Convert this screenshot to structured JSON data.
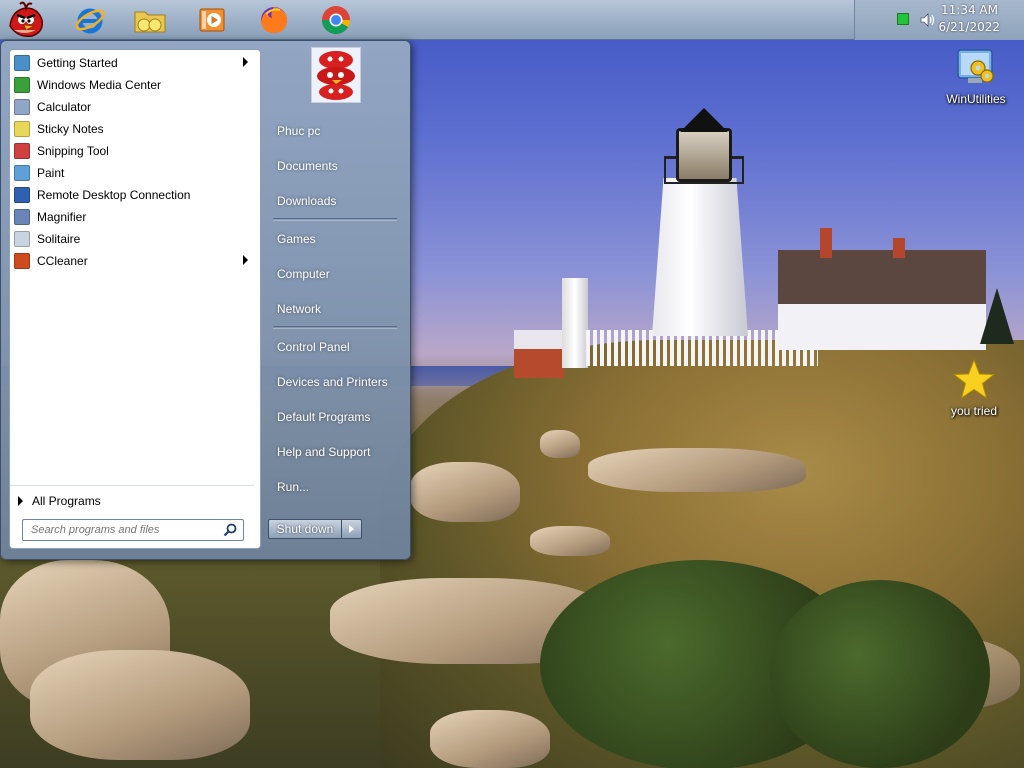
{
  "taskbar": {
    "pinned": [
      {
        "name": "start-orb",
        "icon": "angry-bird-orb-icon"
      },
      {
        "name": "internet-explorer",
        "icon": "internet-explorer-icon"
      },
      {
        "name": "file-explorer",
        "icon": "folder-icon"
      },
      {
        "name": "media-player",
        "icon": "media-player-icon"
      },
      {
        "name": "firefox",
        "icon": "firefox-icon"
      },
      {
        "name": "chrome",
        "icon": "chrome-icon"
      }
    ],
    "tray": {
      "network_icon": "network-status-icon",
      "volume_icon": "speaker-icon",
      "time": "11:34 AM",
      "date": "6/21/2022"
    }
  },
  "start_menu": {
    "programs": [
      {
        "label": "Getting Started",
        "icon": "getting-started-icon",
        "has_submenu": true,
        "color": "#4a90c8"
      },
      {
        "label": "Windows Media Center",
        "icon": "media-center-icon",
        "has_submenu": false,
        "color": "#3aa03a"
      },
      {
        "label": "Calculator",
        "icon": "calculator-icon",
        "has_submenu": false,
        "color": "#8fa7c4"
      },
      {
        "label": "Sticky Notes",
        "icon": "sticky-notes-icon",
        "has_submenu": false,
        "color": "#e8d85a"
      },
      {
        "label": "Snipping Tool",
        "icon": "scissors-icon",
        "has_submenu": false,
        "color": "#d04040"
      },
      {
        "label": "Paint",
        "icon": "paint-icon",
        "has_submenu": false,
        "color": "#5ea0d8"
      },
      {
        "label": "Remote Desktop Connection",
        "icon": "remote-desktop-icon",
        "has_submenu": false,
        "color": "#3060b0"
      },
      {
        "label": "Magnifier",
        "icon": "magnifier-icon",
        "has_submenu": false,
        "color": "#6a86b8"
      },
      {
        "label": "Solitaire",
        "icon": "solitaire-icon",
        "has_submenu": false,
        "color": "#c8d4e0"
      },
      {
        "label": "CCleaner",
        "icon": "ccleaner-icon",
        "has_submenu": true,
        "color": "#d04a20"
      }
    ],
    "all_programs": "All Programs",
    "search_placeholder": "Search programs and files",
    "user_picture_icon": "angry-birds-user-picture",
    "right_items": [
      {
        "label": "Phuc pc"
      },
      {
        "label": "Documents"
      },
      {
        "label": "Downloads"
      },
      {
        "label": "Games"
      },
      {
        "label": "Computer"
      },
      {
        "label": "Network"
      },
      {
        "label": "Control Panel"
      },
      {
        "label": "Devices and Printers"
      },
      {
        "label": "Default Programs"
      },
      {
        "label": "Help and Support"
      },
      {
        "label": "Run..."
      }
    ],
    "shutdown_label": "Shut down"
  },
  "desktop": {
    "icons": [
      {
        "label": "WinUtilities",
        "icon": "winutilities-gears-icon"
      },
      {
        "label": "you tried",
        "icon": "gold-star-icon"
      }
    ]
  }
}
